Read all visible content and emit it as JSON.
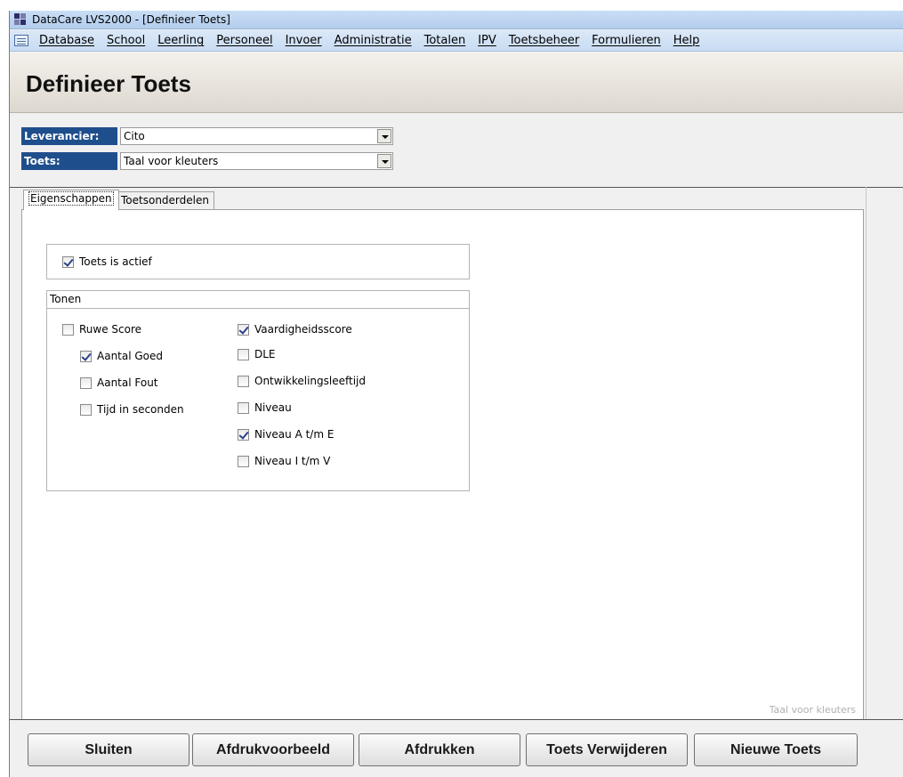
{
  "window": {
    "title": "DataCare LVS2000 - [Definieer Toets]",
    "icon": "app-icon"
  },
  "menu": [
    "Database",
    "School",
    "Leerling",
    "Personeel",
    "Invoer",
    "Administratie",
    "Totalen",
    "IPV",
    "Toetsbeheer",
    "Formulieren",
    "Help"
  ],
  "form": {
    "title": "Definieer Toets"
  },
  "selectors": {
    "leverancier_label": "Leverancier:",
    "leverancier_value": "Cito",
    "toets_label": "Toets:",
    "toets_value": "Taal voor kleuters"
  },
  "tabs": [
    "Eigenschappen",
    "Toetsonderdelen"
  ],
  "properties": {
    "actief_label": "Toets is actief",
    "actief_checked": true,
    "tonen_title": "Tonen",
    "left_options": [
      {
        "label": "Ruwe Score",
        "checked": false
      },
      {
        "label": "Aantal Goed",
        "checked": true
      },
      {
        "label": "Aantal Fout",
        "checked": false
      },
      {
        "label": "Tijd in seconden",
        "checked": false
      }
    ],
    "right_options": [
      {
        "label": "Vaardigheidsscore",
        "checked": true
      },
      {
        "label": "DLE",
        "checked": false
      },
      {
        "label": "Ontwikkelingsleeftijd",
        "checked": false
      },
      {
        "label": "Niveau",
        "checked": false
      },
      {
        "label": "Niveau A t/m E",
        "checked": true
      },
      {
        "label": "Niveau I t/m V",
        "checked": false
      }
    ]
  },
  "panel_footer": "Taal voor kleuters",
  "buttons": [
    "Sluiten",
    "Afdrukvoorbeeld",
    "Afdrukken",
    "Toets Verwijderen",
    "Nieuwe Toets"
  ]
}
